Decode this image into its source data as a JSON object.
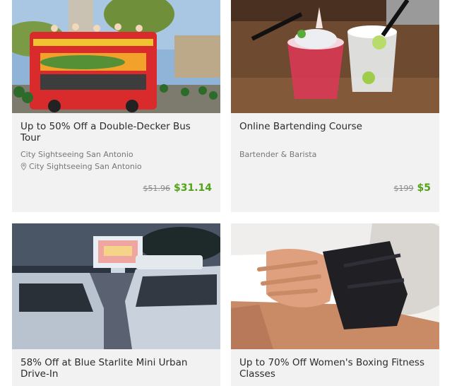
{
  "deals": [
    {
      "title": "Up to 50% Off a Double-Decker Bus Tour",
      "merchant": "City Sightseeing San Antonio",
      "location": "City Sightseeing San Antonio",
      "original_price": "$51.96",
      "sale_price": "$31.14"
    },
    {
      "title": "Online Bartending Course",
      "merchant": "Bartender & Barista",
      "original_price": "$199",
      "sale_price": "$5"
    },
    {
      "title": "58% Off at Blue Starlite Mini Urban Drive-In"
    },
    {
      "title": "Up to 70% Off Women's Boxing Fitness Classes"
    }
  ],
  "icons": {
    "location": "map-pin-icon"
  },
  "colors": {
    "sale_price": "#53a318",
    "card_bg": "#f2f2f2"
  }
}
